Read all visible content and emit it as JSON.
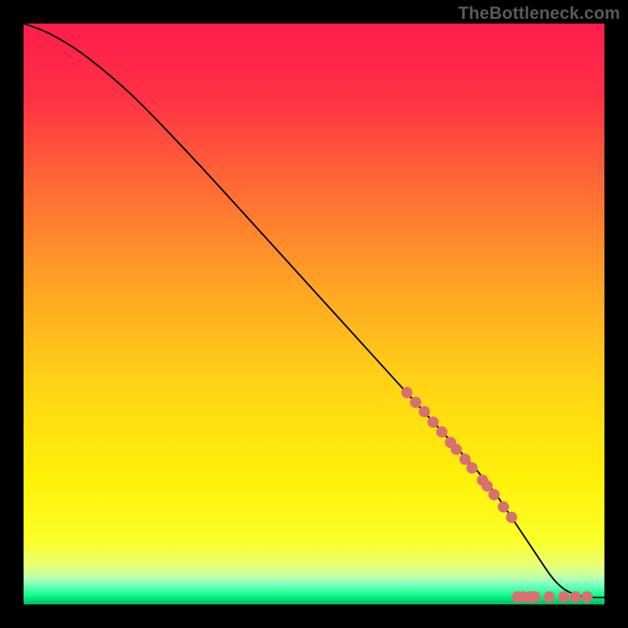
{
  "watermark": "TheBottleneck.com",
  "chart_data": {
    "type": "line",
    "title": "",
    "xlabel": "",
    "ylabel": "",
    "xlim": [
      0,
      100
    ],
    "ylim": [
      0,
      100
    ],
    "series": [
      {
        "name": "curve",
        "x": [
          0,
          3,
          6,
          10,
          15,
          20,
          30,
          40,
          50,
          60,
          70,
          80,
          84,
          88,
          92,
          96,
          100
        ],
        "y": [
          100,
          99,
          97.5,
          95,
          91,
          86.5,
          76,
          65,
          54,
          43,
          32,
          21,
          15,
          9,
          3,
          1.2,
          1.2
        ]
      }
    ],
    "markers": {
      "name": "highlighted-points",
      "x": [
        66,
        67.5,
        69,
        70.5,
        72,
        73.5,
        74.5,
        76,
        77.2,
        79,
        79.8,
        81,
        82.6,
        84,
        85,
        86,
        87.2,
        88.0,
        90.5,
        93,
        95,
        97
      ],
      "y": [
        36.5,
        34.8,
        33.2,
        31.4,
        29.7,
        27.9,
        26.7,
        25.0,
        23.5,
        21.4,
        20.4,
        18.9,
        16.8,
        15.0,
        1.3,
        1.3,
        1.3,
        1.3,
        1.3,
        1.3,
        1.3,
        1.3
      ]
    },
    "marker_radius_px": 7.2,
    "gradient_stops": [
      {
        "offset": 0.0,
        "color": "#ff1d4b"
      },
      {
        "offset": 0.12,
        "color": "#ff2f45"
      },
      {
        "offset": 0.28,
        "color": "#ff6a35"
      },
      {
        "offset": 0.45,
        "color": "#ffa324"
      },
      {
        "offset": 0.62,
        "color": "#ffd315"
      },
      {
        "offset": 0.78,
        "color": "#fff009"
      },
      {
        "offset": 0.89,
        "color": "#fbff27"
      },
      {
        "offset": 0.935,
        "color": "#e8ff79"
      },
      {
        "offset": 0.955,
        "color": "#b6ffb1"
      },
      {
        "offset": 0.968,
        "color": "#6dffbf"
      },
      {
        "offset": 0.982,
        "color": "#1bff8f"
      },
      {
        "offset": 0.992,
        "color": "#02dd77"
      },
      {
        "offset": 1.0,
        "color": "#02b865"
      }
    ]
  }
}
